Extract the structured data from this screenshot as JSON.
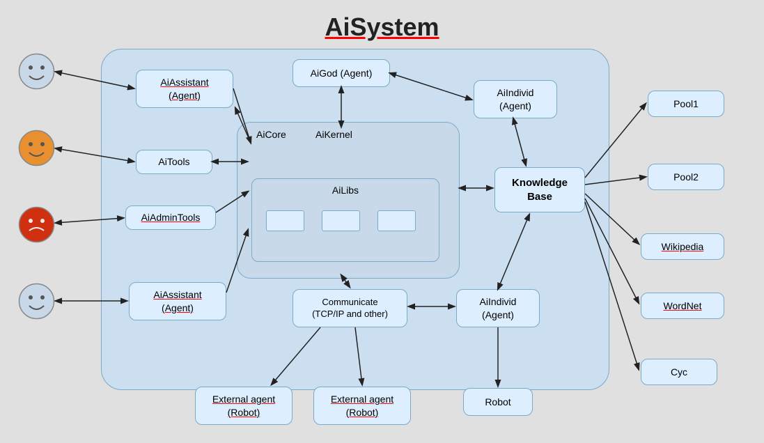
{
  "title": "AiSystem",
  "nodes": {
    "ai_assistant_top": "AiAssistant\n(Agent)",
    "ai_god": "AiGod (Agent)",
    "ai_individ_top": "AiIndivid\n(Agent)",
    "ai_tools": "AiTools",
    "ai_core": "AiCore",
    "ai_kernel": "AiKernel",
    "ai_libs": "AiLibs",
    "ai_admin_tools": "AiAdminTools",
    "knowledge_base": "Knowledge\nBase",
    "communicate": "Communicate\n(TCP/IP and other)",
    "ai_individ_bottom": "AiIndivid\n(Agent)",
    "ai_assistant_bottom": "AiAssistant\n(Agent)",
    "external_agent_1": "External agent\n(Robot)",
    "external_agent_2": "External agent\n(Robot)",
    "robot": "Robot",
    "pool1": "Pool1",
    "pool2": "Pool2",
    "wikipedia": "Wikipedia",
    "wordnet": "WordNet",
    "cyc": "Cyc"
  }
}
